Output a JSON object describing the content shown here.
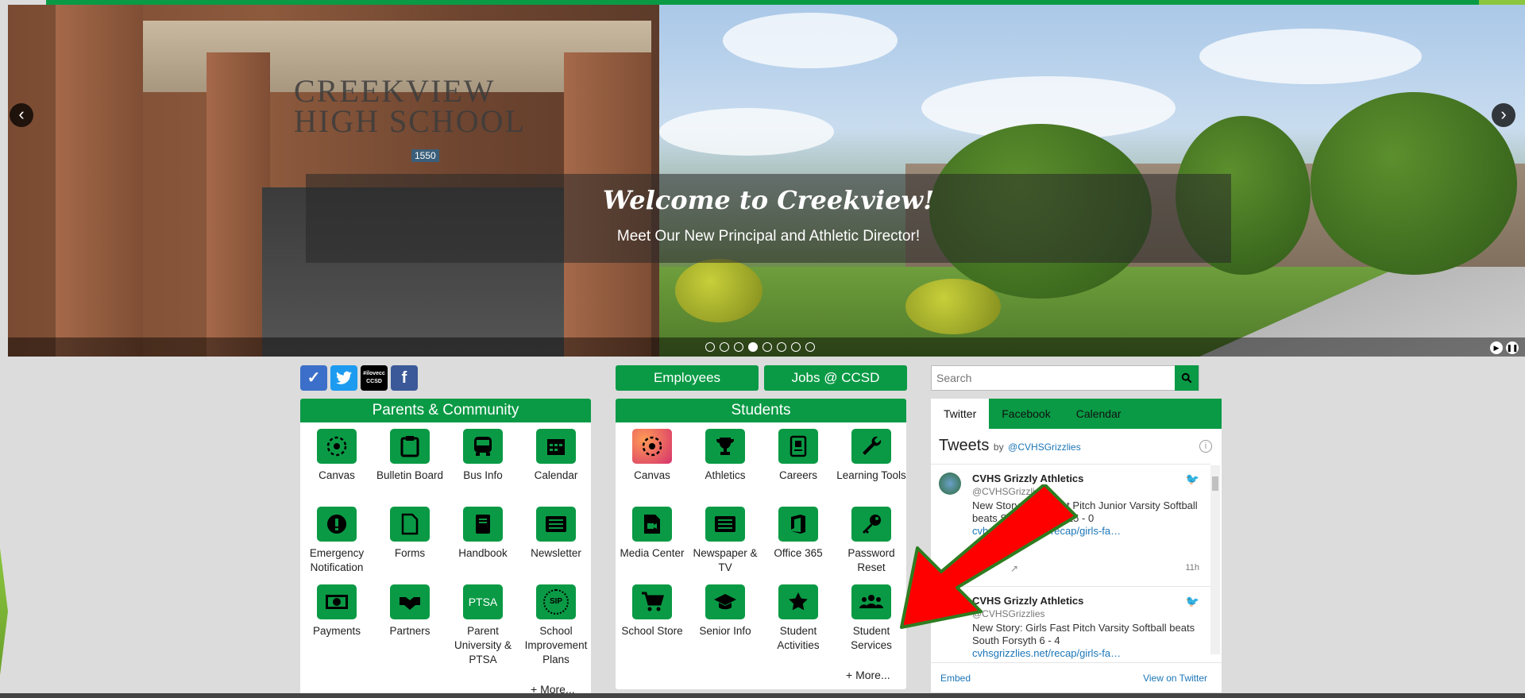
{
  "hero": {
    "sign_text": "CREEKVIEW HIGH SCHOOL",
    "number_sign": "1550",
    "caption_title": "Welcome to Creekview!",
    "caption_subtitle": "Meet Our New Principal and Athletic Director!",
    "prev_icon": "chevron-left-icon",
    "next_icon": "chevron-right-icon",
    "slide_count": 8,
    "active_slide": 4
  },
  "social": [
    "canvas-icon",
    "twitter-icon",
    "ccsd-icon",
    "facebook-icon"
  ],
  "ccsd_badge": "#ilovecc CCSD",
  "buttons": {
    "employees": "Employees",
    "jobs": "Jobs @ CCSD"
  },
  "parents": {
    "title": "Parents & Community",
    "items": [
      {
        "label": "Canvas",
        "icon": "canvas-icon"
      },
      {
        "label": "Bulletin Board",
        "icon": "clipboard-icon"
      },
      {
        "label": "Bus Info",
        "icon": "bus-icon"
      },
      {
        "label": "Calendar",
        "icon": "calendar-icon"
      },
      {
        "label": "Emergency Notification",
        "icon": "alert-icon"
      },
      {
        "label": "Forms",
        "icon": "file-icon"
      },
      {
        "label": "Handbook",
        "icon": "book-icon"
      },
      {
        "label": "Newsletter",
        "icon": "newspaper-icon"
      },
      {
        "label": "Payments",
        "icon": "money-icon"
      },
      {
        "label": "Partners",
        "icon": "handshake-icon"
      },
      {
        "label": "Parent University & PTSA",
        "icon": "ptsa-icon",
        "icon_text": "PTSA"
      },
      {
        "label": "School Improvement Plans",
        "icon": "sip-icon",
        "icon_text": "SIP"
      }
    ],
    "more": "+ More..."
  },
  "students": {
    "title": "Students",
    "items": [
      {
        "label": "Canvas",
        "icon": "canvas-icon"
      },
      {
        "label": "Athletics",
        "icon": "trophy-icon"
      },
      {
        "label": "Careers",
        "icon": "id-badge-icon"
      },
      {
        "label": "Learning Tools",
        "icon": "wrench-icon"
      },
      {
        "label": "Media Center",
        "icon": "video-file-icon"
      },
      {
        "label": "Newspaper & TV",
        "icon": "newspaper-icon"
      },
      {
        "label": "Office 365",
        "icon": "office-icon"
      },
      {
        "label": "Password Reset",
        "icon": "key-icon"
      },
      {
        "label": "School Store",
        "icon": "cart-icon"
      },
      {
        "label": "Senior Info",
        "icon": "graduation-cap-icon"
      },
      {
        "label": "Student Activities",
        "icon": "star-icon"
      },
      {
        "label": "Student Services",
        "icon": "users-icon"
      }
    ],
    "more": "+ More..."
  },
  "search": {
    "placeholder": "Search"
  },
  "feed": {
    "tabs": [
      "Twitter",
      "Facebook",
      "Calendar"
    ],
    "tweets_title": "Tweets",
    "by": "by",
    "handle_link": "@CVHSGrizzlies",
    "tweets": [
      {
        "name": "CVHS Grizzly Athletics",
        "handle": "@CVHSGrizzlies",
        "text": "New Story: Girls Fast Pitch Junior Varsity Softball beats South Forsyth 15 - 0",
        "link": "cvhsgrizzlies.net/recap/girls-fa…",
        "time": "11h"
      },
      {
        "name": "CVHS Grizzly Athletics",
        "handle": "@CVHSGrizzlies",
        "text": "New Story: Girls Fast Pitch Varsity Softball beats South Forsyth 6 - 4",
        "link": "cvhsgrizzlies.net/recap/girls-fa…",
        "time": ""
      }
    ],
    "embed": "Embed",
    "view_on_twitter": "View on Twitter"
  },
  "colors": {
    "brand_green": "#0a9a45",
    "accent_lime": "#8cc63f",
    "annotation_red": "#ff0000"
  }
}
